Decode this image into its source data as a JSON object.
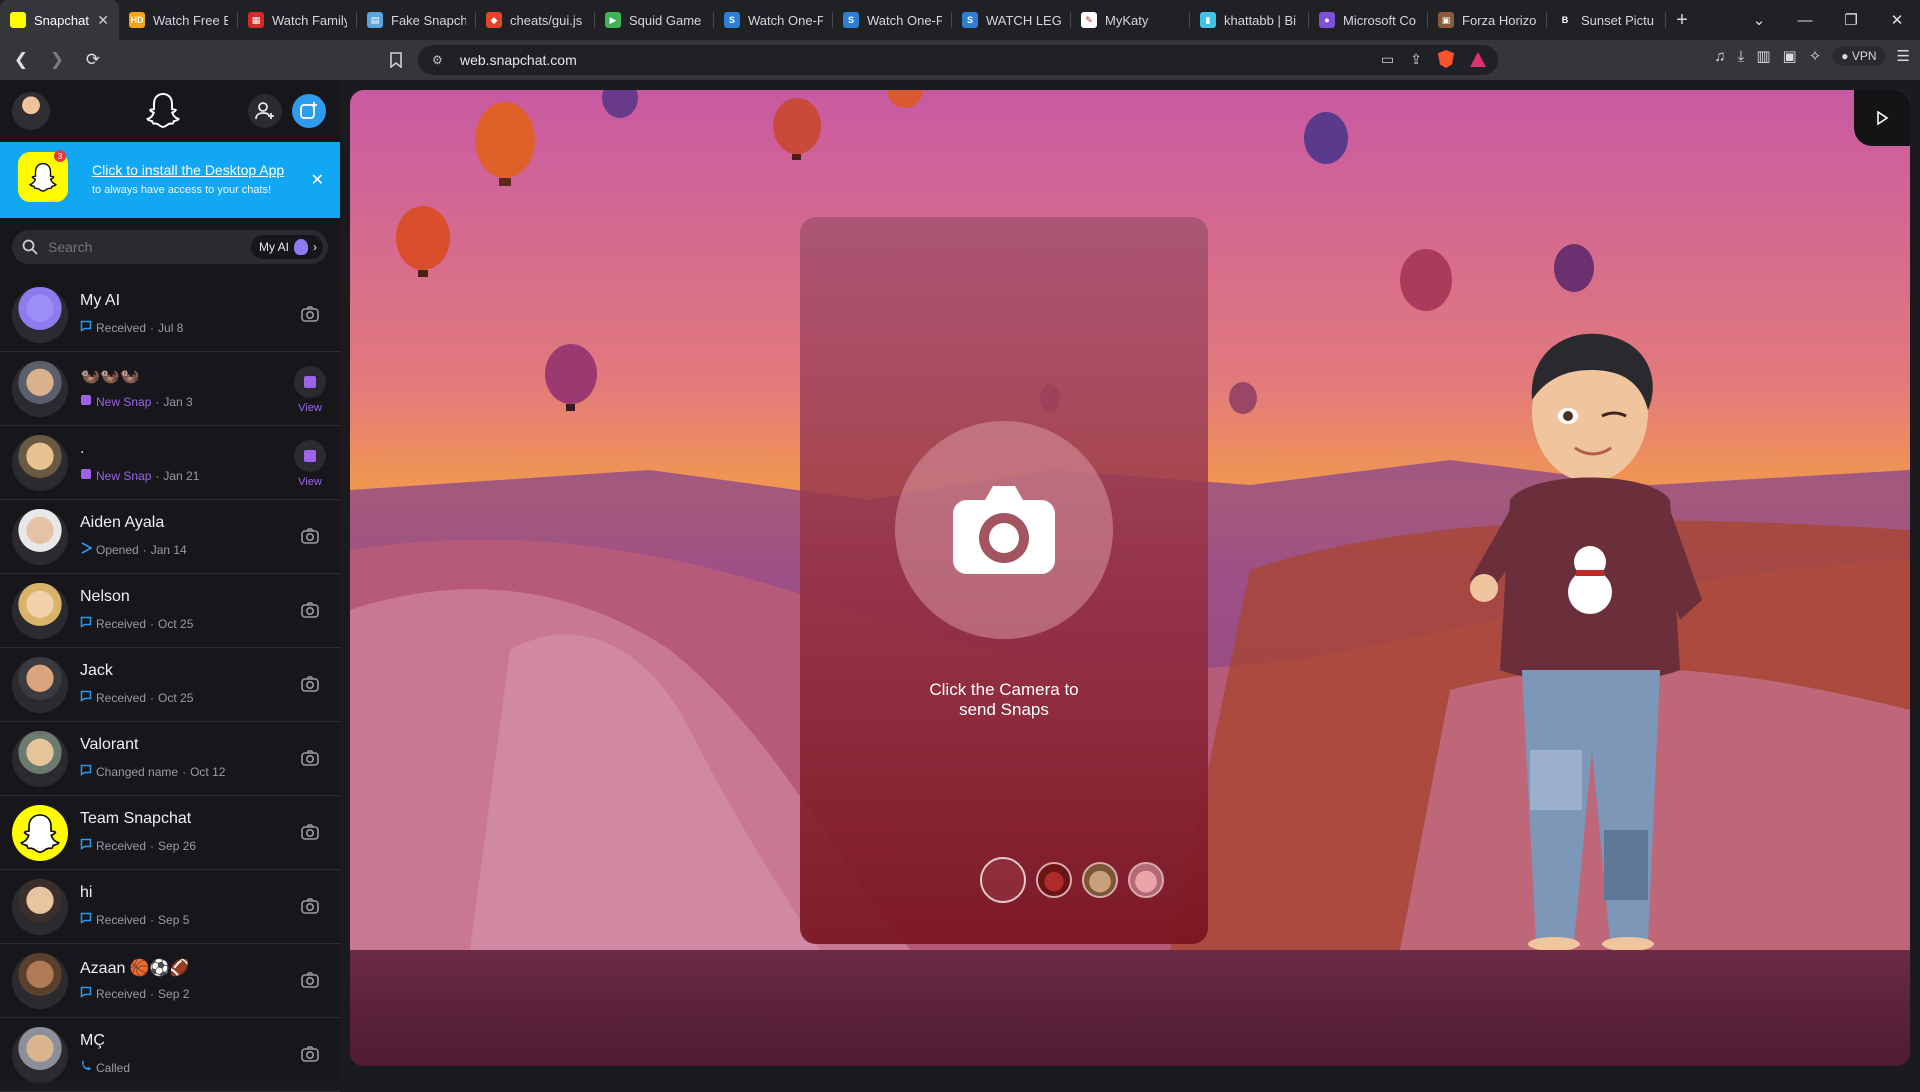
{
  "browser": {
    "tabs": [
      {
        "title": "Snapchat",
        "color": "#fffc00",
        "glyph": "",
        "active": true
      },
      {
        "title": "Watch Free B",
        "color": "#f4a31b",
        "glyph": "HD"
      },
      {
        "title": "Watch Family",
        "color": "#d12b2b",
        "glyph": "▦"
      },
      {
        "title": "Fake Snapch",
        "color": "#5aa6e0",
        "glyph": "▤"
      },
      {
        "title": "cheats/gui.js",
        "color": "#e24329",
        "glyph": "◆"
      },
      {
        "title": "Squid Game",
        "color": "#3eb35a",
        "glyph": "▶"
      },
      {
        "title": "Watch One-P",
        "color": "#2d7fd6",
        "glyph": "S"
      },
      {
        "title": "Watch One-P",
        "color": "#2d7fd6",
        "glyph": "S"
      },
      {
        "title": "WATCH LEGO",
        "color": "#2d7fd6",
        "glyph": "S"
      },
      {
        "title": "MyKaty",
        "color": "#ffffff",
        "glyph": "✎"
      },
      {
        "title": "khattabb | Bi",
        "color": "#3fc4e3",
        "glyph": "▮"
      },
      {
        "title": "Microsoft Co",
        "color": "#7f4fd8",
        "glyph": "●"
      },
      {
        "title": "Forza Horizo",
        "color": "#8a5a3c",
        "glyph": "▣"
      },
      {
        "title": "Sunset Pictu",
        "color": "#202124",
        "glyph": "B"
      }
    ],
    "url": "web.snapchat.com",
    "vpn_label": "VPN"
  },
  "banner": {
    "title": "Click to install the Desktop App",
    "subtitle": "to always have access to your chats!",
    "badge_count": "3"
  },
  "search": {
    "placeholder": "Search",
    "myai_label": "My AI"
  },
  "chats": [
    {
      "name": "My AI",
      "status": "Received",
      "date": "Jul 8",
      "kind": "received",
      "avatar": "#8f7bf0",
      "skin": "#9b8ff5",
      "action": "camera"
    },
    {
      "name": "🦦🦦🦦",
      "status": "New Snap",
      "date": "Jan 3",
      "kind": "newsnap",
      "avatar": "#5a5f6b",
      "skin": "#d9b18c",
      "action": "view"
    },
    {
      "name": ".",
      "status": "New Snap",
      "date": "Jan 21",
      "kind": "newsnap",
      "avatar": "#6a5a44",
      "skin": "#e8c392",
      "action": "view"
    },
    {
      "name": "Aiden Ayala",
      "status": "Opened",
      "date": "Jan 14",
      "kind": "opened",
      "avatar": "#e8e8e8",
      "skin": "#e6c2a4",
      "action": "camera"
    },
    {
      "name": "Nelson",
      "status": "Received",
      "date": "Oct 25",
      "kind": "received",
      "avatar": "#d9b36a",
      "skin": "#f2d0ac",
      "action": "camera"
    },
    {
      "name": "Jack",
      "status": "Received",
      "date": "Oct 25",
      "kind": "received",
      "avatar": "#3a3a3f",
      "skin": "#d9a37e",
      "action": "camera"
    },
    {
      "name": "Valorant",
      "status": "Changed name",
      "date": "Oct 12",
      "kind": "received",
      "avatar": "#6c7a70",
      "skin": "#e7c59a",
      "action": "camera"
    },
    {
      "name": "Team Snapchat",
      "status": "Received",
      "date": "Sep 26",
      "kind": "received",
      "avatar": "#fffc00",
      "skin": "#fffc00",
      "action": "camera"
    },
    {
      "name": "hi",
      "status": "Received",
      "date": "Sep 5",
      "kind": "received",
      "avatar": "#3a2f2a",
      "skin": "#e8c4a0",
      "action": "camera"
    },
    {
      "name": "Azaan 🏀⚽🏈",
      "status": "Received",
      "date": "Sep 2",
      "kind": "received",
      "avatar": "#5a3f2c",
      "skin": "#b07a54",
      "action": "camera"
    },
    {
      "name": "MÇ",
      "status": "Called",
      "date": "",
      "kind": "called",
      "avatar": "#8a8f9a",
      "skin": "#d9b48e",
      "action": "camera"
    }
  ],
  "camera_card": {
    "prompt_line1": "Click the Camera to",
    "prompt_line2": "send Snaps"
  },
  "colors": {
    "accent_blue": "#2d9bf0",
    "banner_blue": "#12a7f2",
    "snap_yellow": "#fffc00",
    "new_snap_purple": "#9c64e8",
    "received_blue": "#2d9bf0"
  }
}
